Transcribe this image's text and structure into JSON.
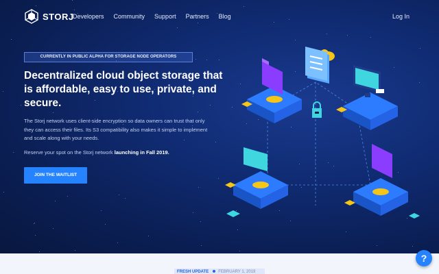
{
  "brand": {
    "name": "STORJ"
  },
  "nav": {
    "links": [
      "Developers",
      "Community",
      "Support",
      "Partners",
      "Blog"
    ],
    "login": "Log In"
  },
  "hero": {
    "badge": "CURRENTLY IN PUBLIC ALPHA FOR STORAGE NODE OPERATORS",
    "headline": "Decentralized cloud object storage that is affordable, easy to use, private, and secure.",
    "description": "The Storj network uses client-side encryption so data owners can trust that only they can access their files. Its S3 compatibility also makes it simple to implement and scale along with your needs.",
    "reserve_prefix": "Reserve your spot on the Storj network ",
    "reserve_bold": "launching in Fall 2019.",
    "cta": "JOIN THE WAITLIST"
  },
  "update": {
    "label": "FRESH UPDATE",
    "date": "FEBRUARY 1, 2019"
  },
  "help": {
    "label": "?"
  },
  "colors": {
    "accent": "#2683ff",
    "hero_bg": "#0b1f55",
    "purple": "#8b3dff",
    "gold": "#f5c518",
    "teal": "#3fd6e0"
  },
  "icons": [
    "storj-logo-icon",
    "cloud-icon",
    "document-icon",
    "lock-icon",
    "monitor-icon",
    "folder-icon",
    "help-icon"
  ]
}
